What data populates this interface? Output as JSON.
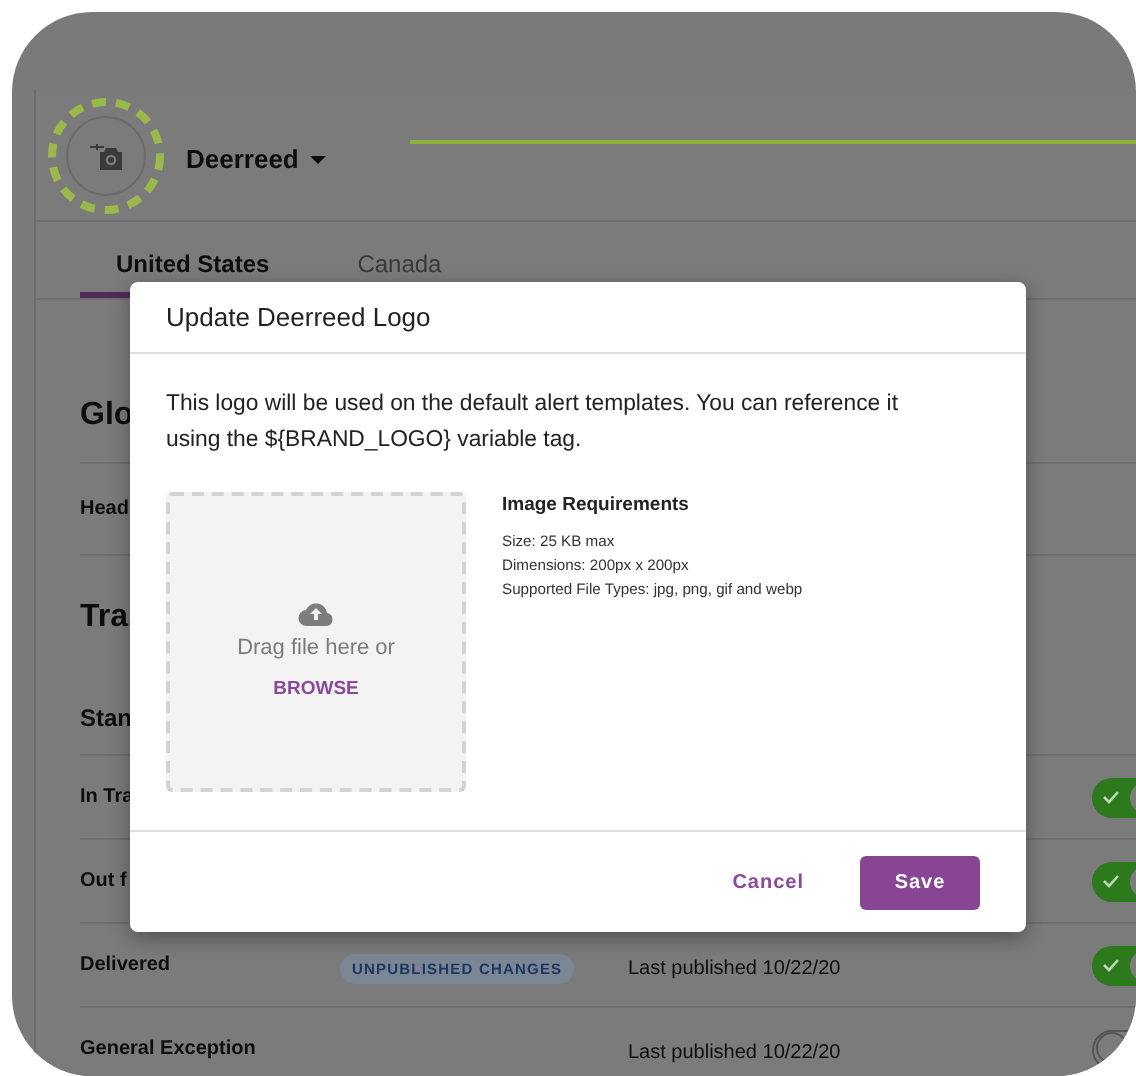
{
  "header": {
    "brand": "Deerreed"
  },
  "tabs": [
    {
      "label": "United States",
      "selected": true
    },
    {
      "label": "Canada",
      "selected": false
    }
  ],
  "rows": [
    {
      "kind": "heading",
      "label": "Glo"
    },
    {
      "kind": "field",
      "label": "Head"
    },
    {
      "kind": "heading",
      "label": "Tra"
    },
    {
      "kind": "subheading",
      "label": "Stan"
    },
    {
      "kind": "status",
      "label": "In Tra",
      "on": true
    },
    {
      "kind": "status",
      "label": "Out f",
      "on": true
    },
    {
      "kind": "status",
      "label": "Delivered",
      "badge": "UNPUBLISHED CHANGES",
      "published": "Last published 10/22/20",
      "on": true
    },
    {
      "kind": "status",
      "label": "General Exception",
      "published": "Last published 10/22/20",
      "on": false
    }
  ],
  "dialog": {
    "title": "Update Deerreed Logo",
    "description": "This logo will be used on the default alert templates. You can reference it using the ${BRAND_LOGO} variable tag.",
    "dropzone": {
      "text": "Drag file here or",
      "link": "BROWSE"
    },
    "requirements": {
      "title": "Image Requirements",
      "lines": [
        "Size: 25 KB max",
        "Dimensions: 200px x 200px",
        "Supported File Types: jpg, png, gif and webp"
      ]
    },
    "buttons": [
      {
        "label": "Cancel",
        "kind": "text"
      },
      {
        "label": "Save",
        "kind": "primary"
      }
    ]
  }
}
